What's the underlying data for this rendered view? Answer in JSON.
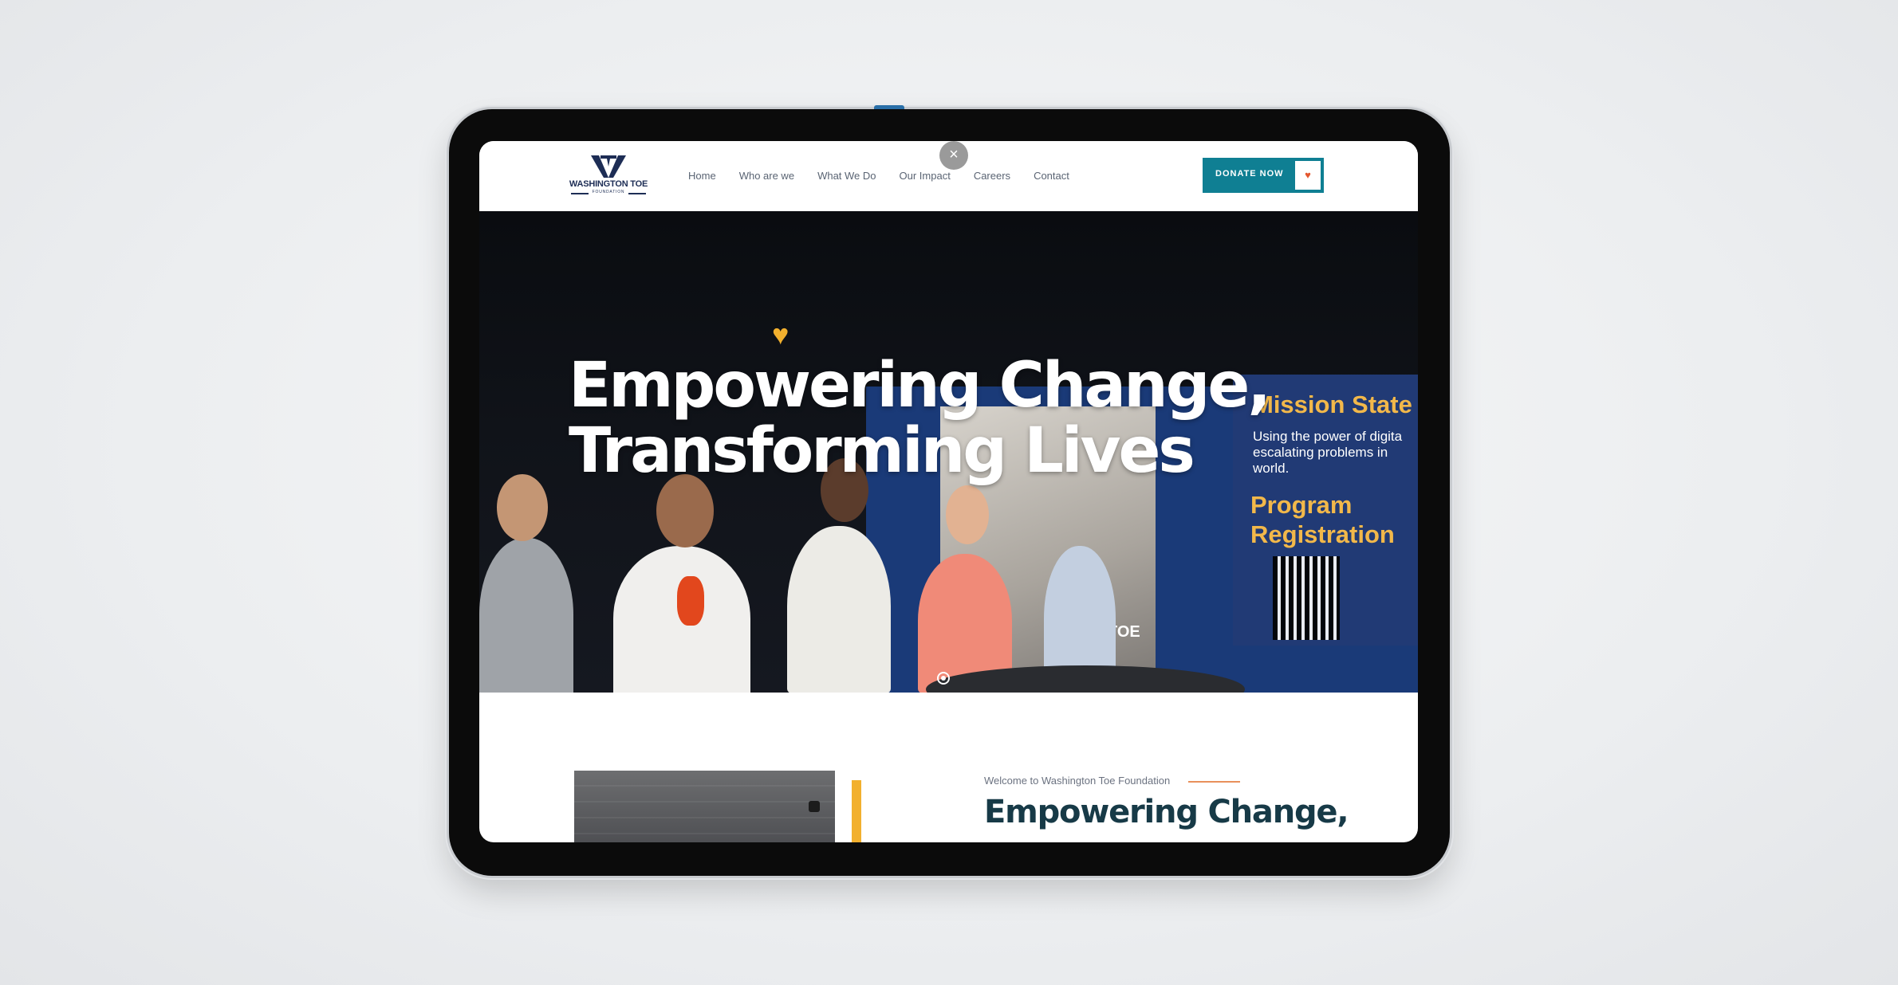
{
  "brand": {
    "name": "WASHINGTON TOE",
    "sub": "FOUNDATION"
  },
  "nav": [
    "Home",
    "Who are we",
    "What We Do",
    "Our Impact",
    "Careers",
    "Contact"
  ],
  "close_icon": "×",
  "donate": {
    "label": "DONATE NOW",
    "icon": "heart-icon",
    "heart": "♥"
  },
  "hero": {
    "heart": "♥",
    "title_line1": "Empowering Change,",
    "title_line2": "Transforming Lives",
    "banner": {
      "mission": "Mission State",
      "mission_text": "Using the power of digita escalating problems in world.",
      "program_line1": "Program",
      "program_line2": "Registration"
    },
    "poster_text": "TOE"
  },
  "about": {
    "eyebrow": "Welcome to Washington Toe Foundation",
    "title": "Empowering Change,"
  },
  "colors": {
    "teal": "#0f7f93",
    "navy": "#1d2d55",
    "gold": "#f2b02e",
    "orange": "#e9905b",
    "heading": "#173a47"
  }
}
